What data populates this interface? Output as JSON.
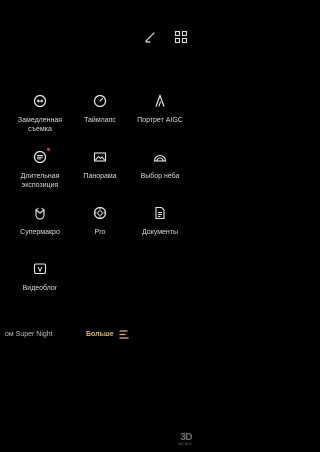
{
  "toolbar": {
    "edit_icon": "pencil-icon",
    "layout_icon": "grid-icon"
  },
  "modes": [
    {
      "label": "Замедленная\nсъемка",
      "icon": "slow-motion-icon"
    },
    {
      "label": "Таймлапс",
      "icon": "timelapse-icon"
    },
    {
      "label": "Портрет AIGC",
      "icon": "portrait-aigc-icon"
    },
    {
      "label": "Длительная\nэкспозиция",
      "icon": "long-exposure-icon",
      "badge": true
    },
    {
      "label": "Панорама",
      "icon": "panorama-icon"
    },
    {
      "label": "Выбор неба",
      "icon": "sky-icon"
    },
    {
      "label": "Супермакро",
      "icon": "supermacro-icon"
    },
    {
      "label": "Pro",
      "icon": "pro-icon"
    },
    {
      "label": "Документы",
      "icon": "documents-icon"
    },
    {
      "label": "Видеоблог",
      "icon": "vlog-icon"
    }
  ],
  "mode_bar": {
    "prev_mode": "ом Super Night",
    "current": "Больше",
    "accent": "#e3b94f"
  },
  "watermark": {
    "line1": "3D",
    "line2": "NEWS"
  }
}
